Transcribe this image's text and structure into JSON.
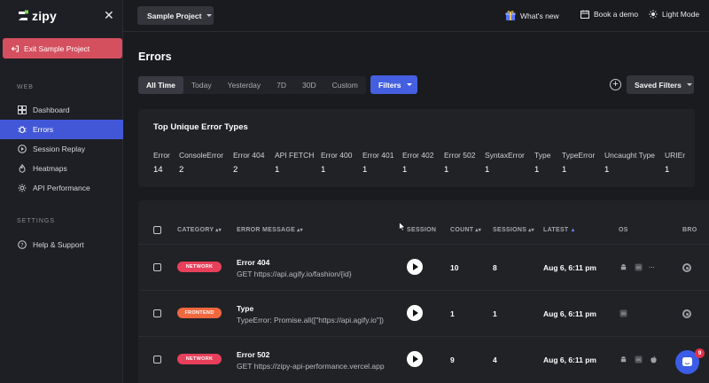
{
  "brand": {
    "name": "zipy"
  },
  "sidebar": {
    "exit_label": "Exit Sample Project",
    "web_label": "WEB",
    "settings_label": "SETTINGS",
    "items": [
      {
        "label": "Dashboard",
        "icon": "dashboard-icon"
      },
      {
        "label": "Errors",
        "icon": "bug-icon"
      },
      {
        "label": "Session Replay",
        "icon": "play-icon"
      },
      {
        "label": "Heatmaps",
        "icon": "flame-icon"
      },
      {
        "label": "API Performance",
        "icon": "gear-icon"
      }
    ],
    "settings_items": [
      {
        "label": "Help & Support",
        "icon": "help-icon"
      }
    ]
  },
  "topbar": {
    "project": "Sample Project",
    "whats_new": "What's new",
    "book_demo": "Book a demo",
    "light_mode": "Light Mode"
  },
  "page": {
    "title": "Errors",
    "ranges": [
      "All Time",
      "Today",
      "Yesterday",
      "7D",
      "30D",
      "Custom"
    ],
    "active_range": "All Time",
    "filters_label": "Filters",
    "saved_filters_label": "Saved Filters"
  },
  "error_types": {
    "title": "Top Unique Error Types",
    "items": [
      {
        "name": "Error",
        "count": "14"
      },
      {
        "name": "ConsoleError",
        "count": "2"
      },
      {
        "name": "Error 404",
        "count": "2"
      },
      {
        "name": "API FETCH",
        "count": "1"
      },
      {
        "name": "Error 400",
        "count": "1"
      },
      {
        "name": "Error 401",
        "count": "1"
      },
      {
        "name": "Error 402",
        "count": "1"
      },
      {
        "name": "Error 502",
        "count": "1"
      },
      {
        "name": "SyntaxError",
        "count": "1"
      },
      {
        "name": "Type",
        "count": "1"
      },
      {
        "name": "TypeError",
        "count": "1"
      },
      {
        "name": "Uncaught Type",
        "count": "1"
      },
      {
        "name": "URIEr",
        "count": "1"
      }
    ]
  },
  "table": {
    "headers": {
      "category": "CATEGORY",
      "message": "ERROR MESSAGE",
      "session": "SESSION",
      "count": "COUNT",
      "sessions": "SESSIONS",
      "latest": "LATEST",
      "os": "OS",
      "browser": "BRO"
    },
    "rows": [
      {
        "category": "NETWORK",
        "category_color": "#e8405a",
        "title": "Error 404",
        "message": "GET https://api.agify.io/fashion/{id}",
        "count": "10",
        "sessions": "8",
        "latest": "Aug 6, 6:11 pm",
        "os_more": "..."
      },
      {
        "category": "FRONTEND",
        "category_color": "#f0683e",
        "title": "Type",
        "message": "TypeError: Promise.all([\"https://api.agify.io\"])",
        "count": "1",
        "sessions": "1",
        "latest": "Aug 6, 6:11 pm",
        "os_more": ""
      },
      {
        "category": "NETWORK",
        "category_color": "#e8405a",
        "title": "Error 502",
        "message": "GET https://zipy-api-performance.vercel.app",
        "count": "9",
        "sessions": "4",
        "latest": "Aug 6, 6:11 pm",
        "os_more": ""
      }
    ]
  },
  "chat": {
    "badge": "9"
  },
  "colors": {
    "accent": "#4257d8",
    "exit": "#d4505f",
    "filters": "#4460e0"
  }
}
